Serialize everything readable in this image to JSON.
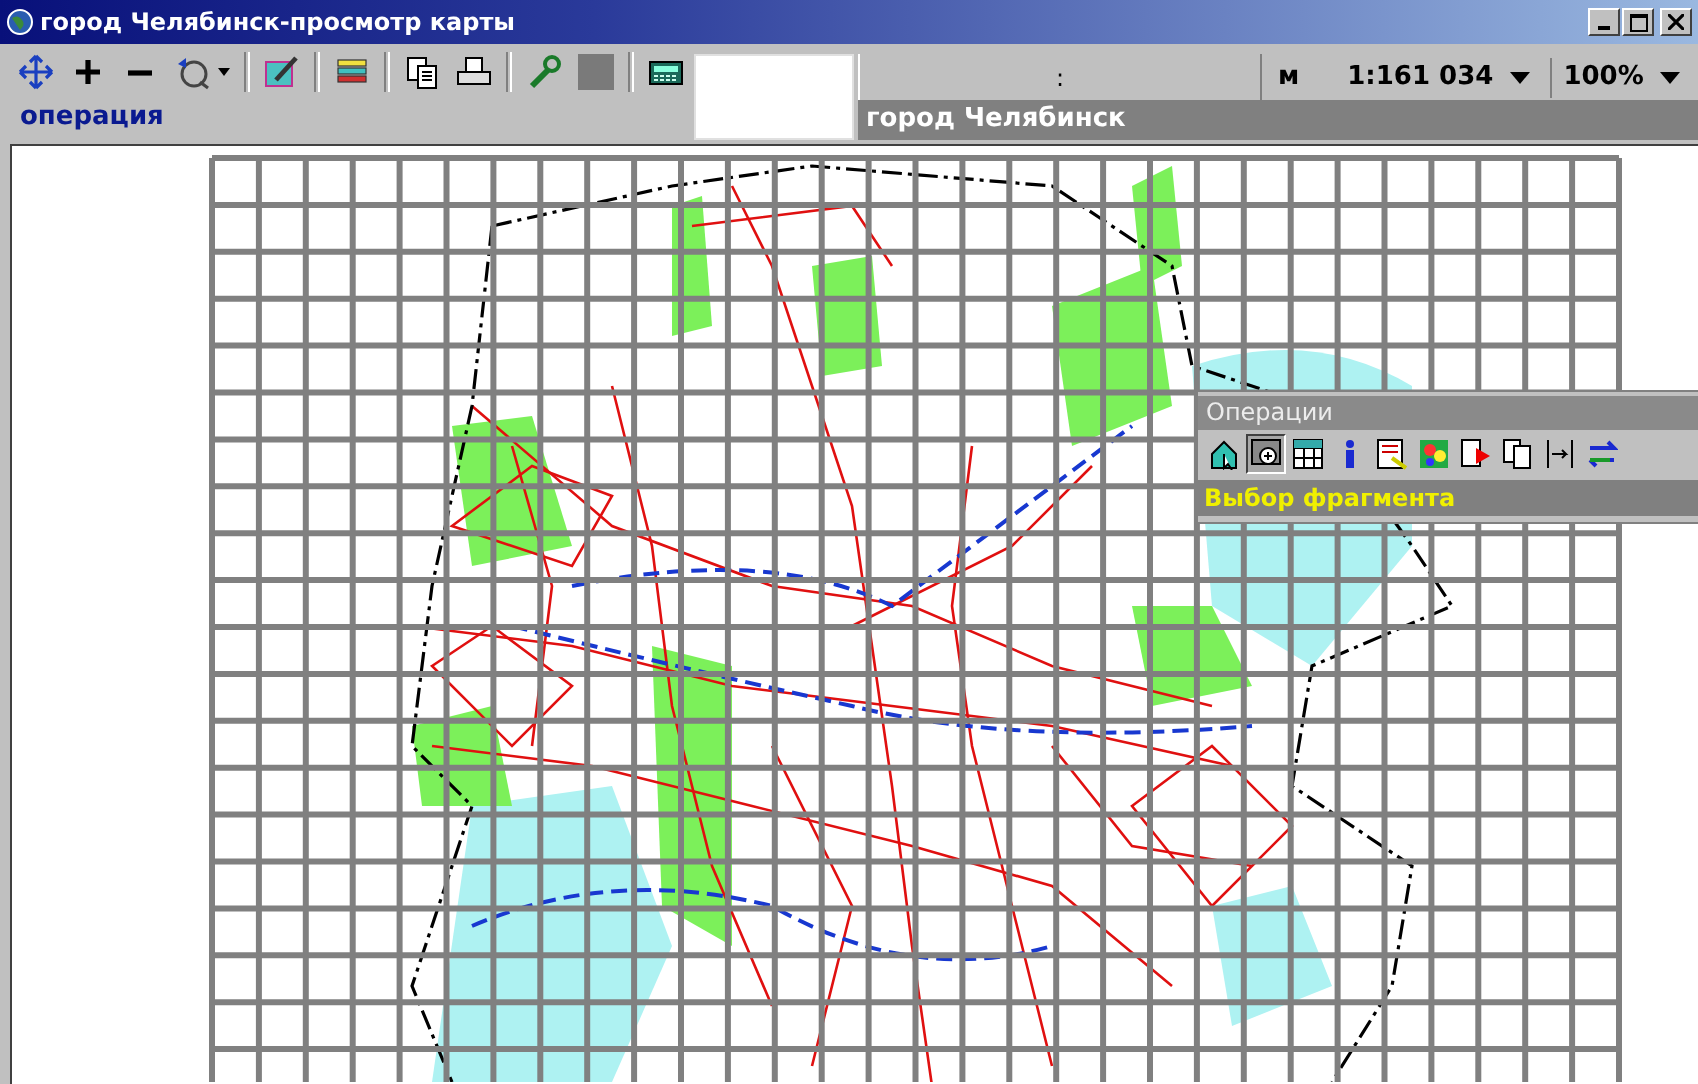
{
  "window": {
    "title": "город Челябинск-просмотр карты"
  },
  "toolbar": {
    "operation": "операция"
  },
  "status": {
    "coordinates": ":",
    "units": "м",
    "scale": "1:161 034",
    "zoom": "100%",
    "layer": "город Челябинск"
  },
  "operations_panel": {
    "title": "Операции",
    "status": "Выбор фрагмента",
    "tools": [
      {
        "selected": false
      },
      {
        "selected": true
      },
      {
        "selected": false
      },
      {
        "selected": false
      },
      {
        "selected": false
      },
      {
        "selected": false
      },
      {
        "selected": false
      },
      {
        "selected": false
      },
      {
        "selected": false
      },
      {
        "selected": false
      }
    ]
  }
}
